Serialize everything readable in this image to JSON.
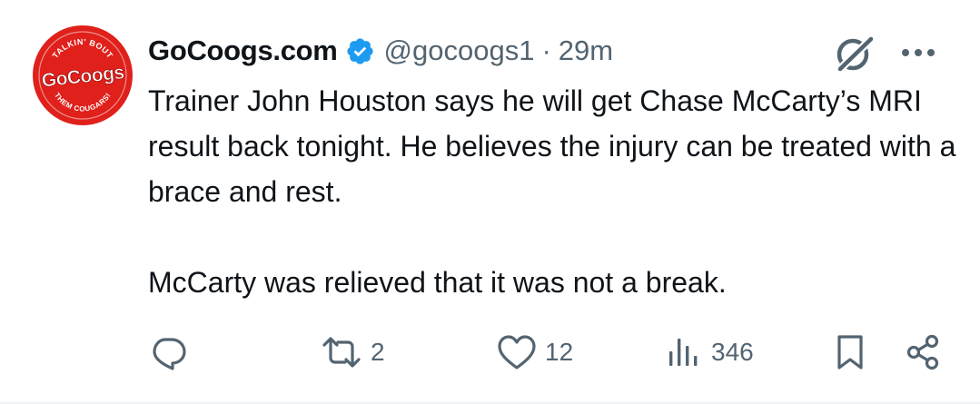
{
  "author": {
    "name": "GoCoogs.com",
    "handle": "@gocoogs1",
    "separator": "·",
    "time": "29m",
    "avatar": {
      "main": "GoCoogs",
      "top": "TALKIN' BOUT",
      "bottom": "THEM COUGARS!"
    }
  },
  "tweet": {
    "text": "Trainer John Houston says he will get Chase McCarty’s MRI result back tonight. He believes the injury can be treated with a brace and rest.\n\nMcCarty was relieved that it was not a break."
  },
  "actions": {
    "reply_count": "",
    "retweet_count": "2",
    "like_count": "12",
    "views_count": "346"
  },
  "icons": {
    "avatar": "gocoogs-logo-icon",
    "verified": "verified-badge-icon",
    "grok": "grok-icon",
    "more": "more-icon",
    "reply": "reply-icon",
    "retweet": "retweet-icon",
    "like": "like-icon",
    "views": "views-icon",
    "bookmark": "bookmark-icon",
    "share": "share-icon"
  },
  "colors": {
    "brand_red": "#e0201b",
    "verified_blue": "#1d9bf0",
    "text_primary": "#0f1419",
    "text_secondary": "#536471"
  }
}
